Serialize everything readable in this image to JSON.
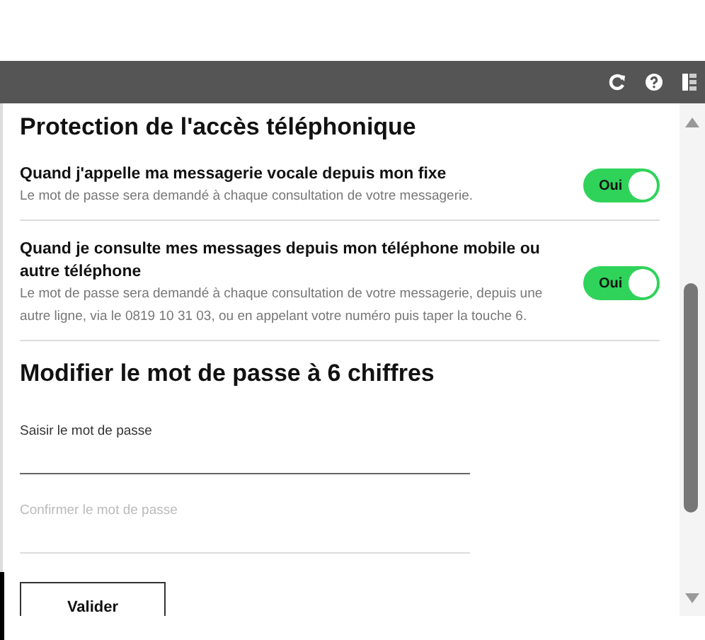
{
  "title": "Protection de l'accès téléphonique",
  "options": [
    {
      "label": "Quand j'appelle ma messagerie vocale depuis mon fixe",
      "description": "Le mot de passe sera demandé à chaque consultation de votre messagerie.",
      "toggle_text": "Oui",
      "on": true
    },
    {
      "label": "Quand je consulte mes messages depuis mon téléphone mobile ou autre téléphone",
      "description": "Le mot de passe sera demandé à chaque consultation de votre messagerie, depuis une autre ligne, via le 0819 10 31 03, ou en appelant votre numéro puis taper la touche 6.",
      "toggle_text": "Oui",
      "on": true
    }
  ],
  "password_section": {
    "title": "Modifier le mot de passe à 6 chiffres",
    "fields": [
      {
        "label": "Saisir le mot de passe",
        "active": true
      },
      {
        "label": "Confirmer le mot de passe",
        "active": false
      }
    ],
    "button": "Valider"
  }
}
